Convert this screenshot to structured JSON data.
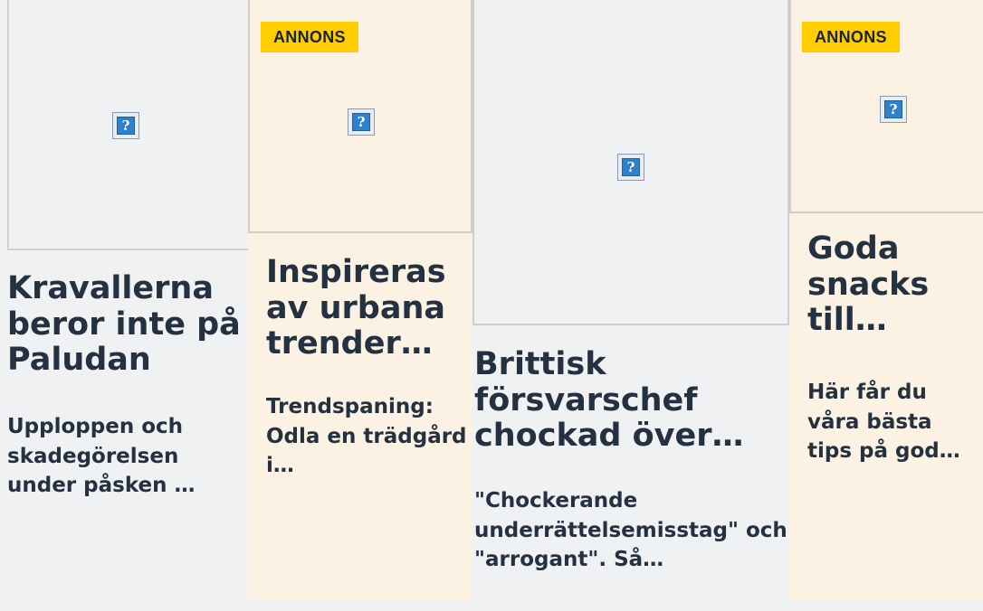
{
  "cards": [
    {
      "title": "Kravallerna beror inte på Paludan",
      "description": "Upploppen och skadegörelsen under påsken …",
      "sponsored": false,
      "image_alt_icon": "broken-image-icon"
    },
    {
      "badge": "ANNONS",
      "title": "Inspireras av urbana trender…",
      "description": "Trendspaning: Odla en trädgård i…",
      "sponsored": true,
      "image_alt_icon": "broken-image-icon"
    },
    {
      "title": "Brittisk försvarschef chockad över…",
      "description": "\"Chockerande underrättelsemisstag\" och \"arrogant\". Så…",
      "sponsored": false,
      "image_alt_icon": "broken-image-icon"
    },
    {
      "badge": "ANNONS",
      "title": "Goda snacks till…",
      "description": "Här får du våra bästa tips på god…",
      "sponsored": true,
      "image_alt_icon": "broken-image-icon"
    }
  ],
  "colors": {
    "page_background": "#f0f1f3",
    "ad_background": "#fbf2e4",
    "badge": "#ffcd00",
    "text": "#243140"
  }
}
